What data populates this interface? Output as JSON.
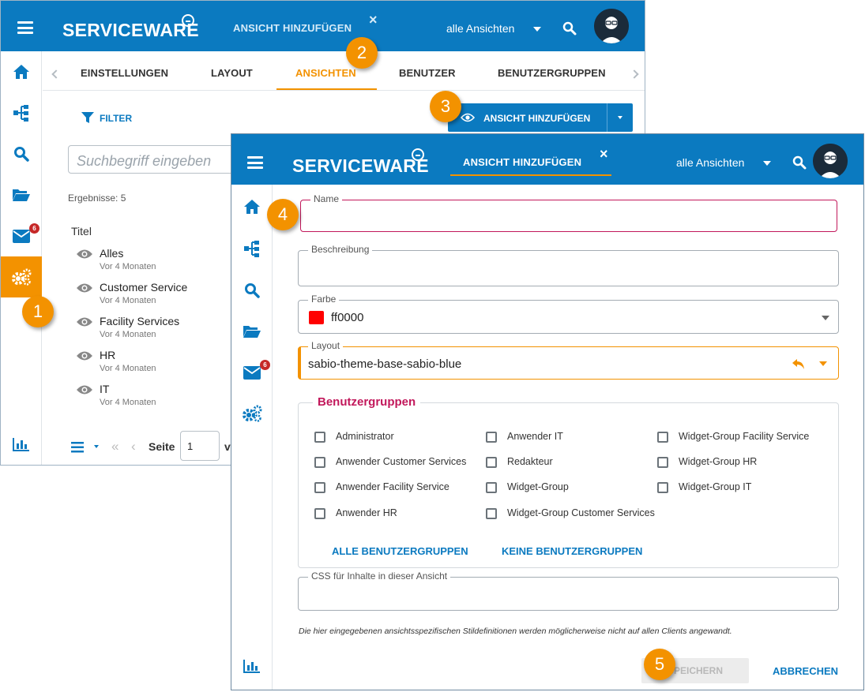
{
  "colors": {
    "brand_blue": "#0b7ac0",
    "accent_orange": "#f39200",
    "error_pink": "#c2185b",
    "color_swatch": "#ff0000"
  },
  "app": {
    "brand": "SERVICEWARE"
  },
  "window1": {
    "header": {
      "tab_label": "ANSICHT HINZUFÜGEN",
      "close_glyph": "×",
      "views_dropdown": "alle Ansichten"
    },
    "sidebar": {
      "icons": [
        "home-icon",
        "sitemap-icon",
        "search-icon",
        "folder-icon",
        "mail-icon",
        "gears-icon",
        "chart-icon"
      ],
      "mail_badge": "6"
    },
    "tabs": [
      "EINSTELLUNGEN",
      "LAYOUT",
      "ANSICHTEN",
      "BENUTZER",
      "BENUTZERGRUPPEN"
    ],
    "active_tab": "ANSICHTEN",
    "toolbar": {
      "filter": "FILTER",
      "add_view": "ANSICHT HINZUFÜGEN"
    },
    "search": {
      "placeholder": "Suchbegriff eingeben"
    },
    "results_text": "Ergebnisse: 5",
    "column_title": "Titel",
    "items": [
      {
        "title": "Alles",
        "age": "Vor 4 Monaten"
      },
      {
        "title": "Customer Service",
        "age": "Vor 4 Monaten"
      },
      {
        "title": "Facility Services",
        "age": "Vor 4 Monaten"
      },
      {
        "title": "HR",
        "age": "Vor 4 Monaten"
      },
      {
        "title": "IT",
        "age": "Vor 4 Monaten"
      }
    ],
    "pager": {
      "page_label": "Seite",
      "page_value": "1",
      "of_label": "vo"
    }
  },
  "window2": {
    "header": {
      "tab_label": "ANSICHT HINZUFÜGEN",
      "close_glyph": "×",
      "views_dropdown": "alle Ansichten"
    },
    "sidebar": {
      "mail_badge": "6"
    },
    "form": {
      "name": {
        "label": "Name",
        "value": ""
      },
      "description": {
        "label": "Beschreibung",
        "value": ""
      },
      "color": {
        "label": "Farbe",
        "value": "ff0000"
      },
      "layout": {
        "label": "Layout",
        "value": "sabio-theme-base-sabio-blue"
      },
      "groups_legend": "Benutzergruppen",
      "groups": [
        [
          "Administrator",
          "Anwender Customer Services",
          "Anwender Facility Service",
          "Anwender HR"
        ],
        [
          "Anwender IT",
          "Redakteur",
          "Widget-Group",
          "Widget-Group Customer Services"
        ],
        [
          "Widget-Group Facility Service",
          "Widget-Group HR",
          "Widget-Group IT"
        ]
      ],
      "all_groups": "ALLE BENUTZERGRUPPEN",
      "no_groups": "KEINE BENUTZERGRUPPEN",
      "css": {
        "label": "CSS für Inhalte in dieser Ansicht",
        "value": ""
      },
      "note": "Die hier eingegebenen ansichtsspezifischen Stildefinitionen werden möglicherweise nicht auf allen Clients angewandt.",
      "save": "SPEICHERN",
      "cancel": "ABBRECHEN"
    }
  },
  "steps": [
    "1",
    "2",
    "3",
    "4",
    "5"
  ]
}
